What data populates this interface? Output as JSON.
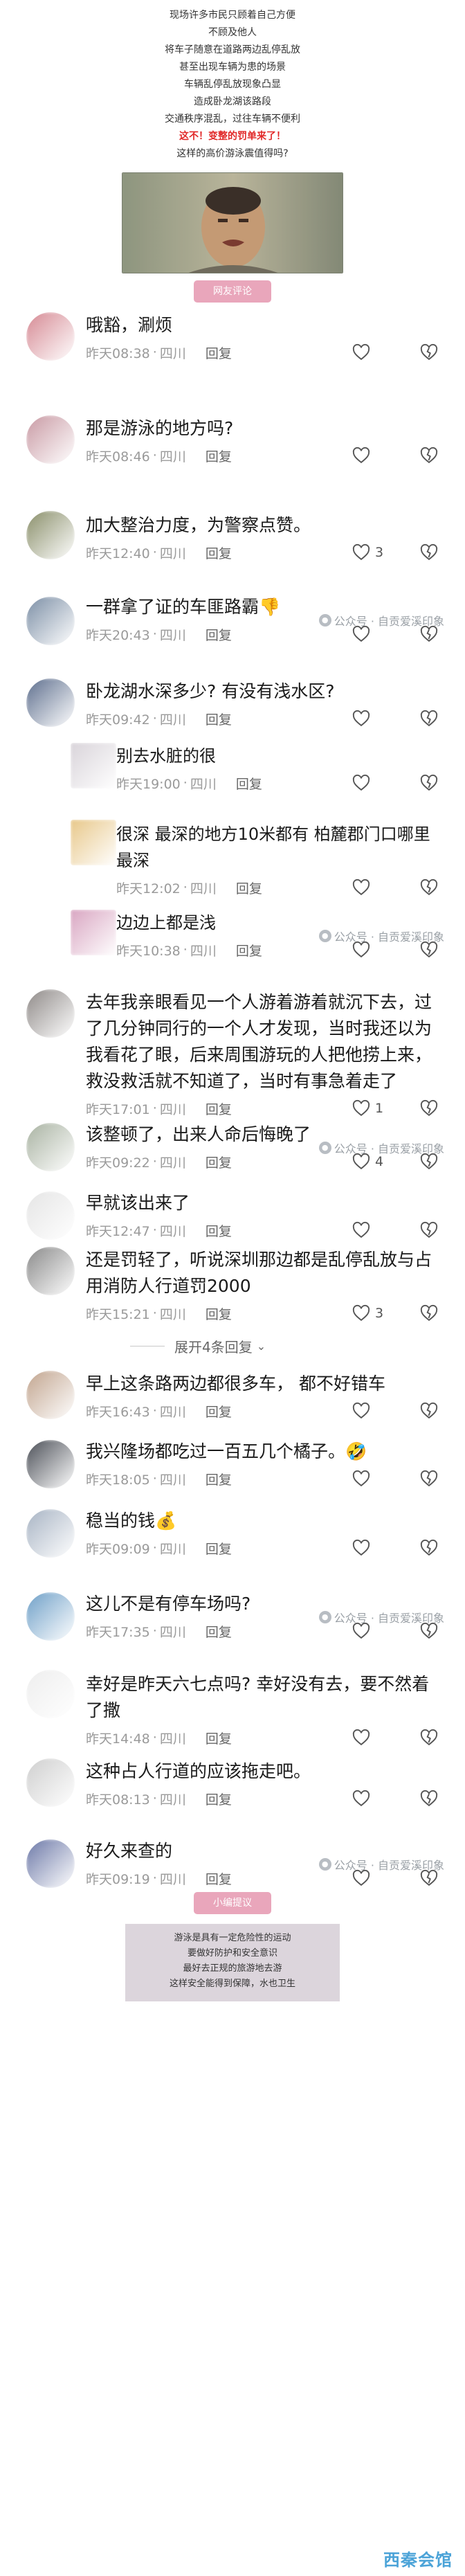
{
  "intro": {
    "lines": [
      {
        "text": "现场许多市民只顾着自己方便",
        "emphasis": false
      },
      {
        "text": "不顾及他人",
        "emphasis": false
      },
      {
        "text": "将车子随意在道路两边乱停乱放",
        "emphasis": false
      },
      {
        "text": "甚至出现车辆为患的场景",
        "emphasis": false
      },
      {
        "text": "车辆乱停乱放现象凸显",
        "emphasis": false
      },
      {
        "text": "造成卧龙湖该路段",
        "emphasis": false
      },
      {
        "text": "交通秩序混乱，过往车辆不便利",
        "emphasis": false
      },
      {
        "text": "这不！变整的罚单来了！",
        "emphasis": true
      },
      {
        "text": "这样的高价游泳震值得吗?",
        "emphasis": false
      }
    ],
    "section_label": "网友评论"
  },
  "watermark_text": "公众号 · 自贡爱溪印象",
  "comments": [
    {
      "level": "top",
      "text": "哦豁，涮烦",
      "time": "昨天08:38",
      "location": "四川",
      "reply_label": "回复",
      "likes": "",
      "avatar_color": "#d68a94",
      "watermark": false
    },
    {
      "level": "top",
      "text": "那是游泳的地方吗?",
      "time": "昨天08:46",
      "location": "四川",
      "reply_label": "回复",
      "likes": "",
      "avatar_color": "#c99aa4",
      "watermark": false
    },
    {
      "level": "top",
      "text": "加大整治力度，为警察点赞。",
      "time": "昨天12:40",
      "location": "四川",
      "reply_label": "回复",
      "likes": "3",
      "avatar_color": "#8a8f6a",
      "watermark": false
    },
    {
      "level": "top",
      "text": "一群拿了证的车匪路霸👎",
      "time": "昨天20:43",
      "location": "四川",
      "reply_label": "回复",
      "likes": "",
      "avatar_color": "#7c8fa6",
      "watermark": true
    },
    {
      "level": "top",
      "text": "卧龙湖水深多少? 有没有浅水区?",
      "time": "昨天09:42",
      "location": "四川",
      "reply_label": "回复",
      "likes": "",
      "avatar_color": "#5e6f8e",
      "watermark": false
    },
    {
      "level": "reply",
      "text": "别去水脏的很",
      "time": "昨天19:00",
      "location": "四川",
      "reply_label": "回复",
      "likes": "",
      "avatar_color": "#d9d4da",
      "watermark": false
    },
    {
      "level": "reply",
      "text": "很深 最深的地方10米都有 柏麓郡门口哪里最深",
      "time": "昨天12:02",
      "location": "四川",
      "reply_label": "回复",
      "likes": "",
      "avatar_color": "#e8c88a",
      "watermark": false
    },
    {
      "level": "reply",
      "text": "边边上都是浅",
      "time": "昨天10:38",
      "location": "四川",
      "reply_label": "回复",
      "likes": "",
      "avatar_color": "#d9a6c2",
      "watermark": true
    },
    {
      "level": "top",
      "text": "去年我亲眼看见一个人游着游着就沉下去，过了几分钟同行的一个人才发现，当时我还以为我看花了眼，后来周围游玩的人把他捞上来，救没救活就不知道了，当时有事急着走了",
      "time": "昨天17:01",
      "location": "四川",
      "reply_label": "回复",
      "likes": "1",
      "avatar_color": "#8f8a88",
      "watermark": false
    },
    {
      "level": "top",
      "text": "该整顿了，出来人命后悔晚了",
      "time": "昨天09:22",
      "location": "四川",
      "reply_label": "回复",
      "likes": "4",
      "avatar_color": "#a9b3a2",
      "watermark": true
    },
    {
      "level": "top",
      "text": "早就该出来了",
      "time": "昨天12:47",
      "location": "四川",
      "reply_label": "回复",
      "likes": "",
      "avatar_color": "#e5e5e5",
      "watermark": false
    },
    {
      "level": "top",
      "text": "还是罚轻了，听说深圳那边都是乱停乱放与占用消防人行道罚2000",
      "time": "昨天15:21",
      "location": "四川",
      "reply_label": "回复",
      "likes": "3",
      "avatar_color": "#8a8a8a",
      "watermark": false
    },
    {
      "level": "top",
      "text": "早上这条路两边都很多车，  都不好错车",
      "time": "昨天16:43",
      "location": "四川",
      "reply_label": "回复",
      "likes": "",
      "avatar_color": "#c2a58f",
      "watermark": false
    },
    {
      "level": "top",
      "text": "我兴隆场都吃过一百五几个橘子。🤣",
      "time": "昨天18:05",
      "location": "四川",
      "reply_label": "回复",
      "likes": "",
      "avatar_color": "#4b4f57",
      "watermark": false
    },
    {
      "level": "top",
      "text": "稳当的钱💰",
      "time": "昨天09:09",
      "location": "四川",
      "reply_label": "回复",
      "likes": "",
      "avatar_color": "#a8b4c4",
      "watermark": false
    },
    {
      "level": "top",
      "text": "这儿不是有停车场吗?",
      "time": "昨天17:35",
      "location": "四川",
      "reply_label": "回复",
      "likes": "",
      "avatar_color": "#6fa0c8",
      "watermark": true
    },
    {
      "level": "top",
      "text": "幸好是昨天六七点吗? 幸好没有去，要不然着了撒",
      "time": "昨天14:48",
      "location": "四川",
      "reply_label": "回复",
      "likes": "",
      "avatar_color": "#eeeeee",
      "watermark": false
    },
    {
      "level": "top",
      "text": "这种占人行道的应该拖走吧。",
      "time": "昨天08:13",
      "location": "四川",
      "reply_label": "回复",
      "likes": "",
      "avatar_color": "#cfcfcf",
      "watermark": false
    },
    {
      "level": "top",
      "text": "好久来查的",
      "time": "昨天09:19",
      "location": "四川",
      "reply_label": "回复",
      "likes": "",
      "avatar_color": "#6d79a8",
      "watermark": true
    }
  ],
  "expand_label": "展开4条回复",
  "footer": {
    "section_label": "小编提议",
    "lines": [
      "游泳是具有一定危险性的运动",
      "要做好防护和安全意识",
      "最好去正规的旅游地去游",
      "这样安全能得到保障，水也卫生"
    ],
    "brand": "西秦会馆"
  }
}
